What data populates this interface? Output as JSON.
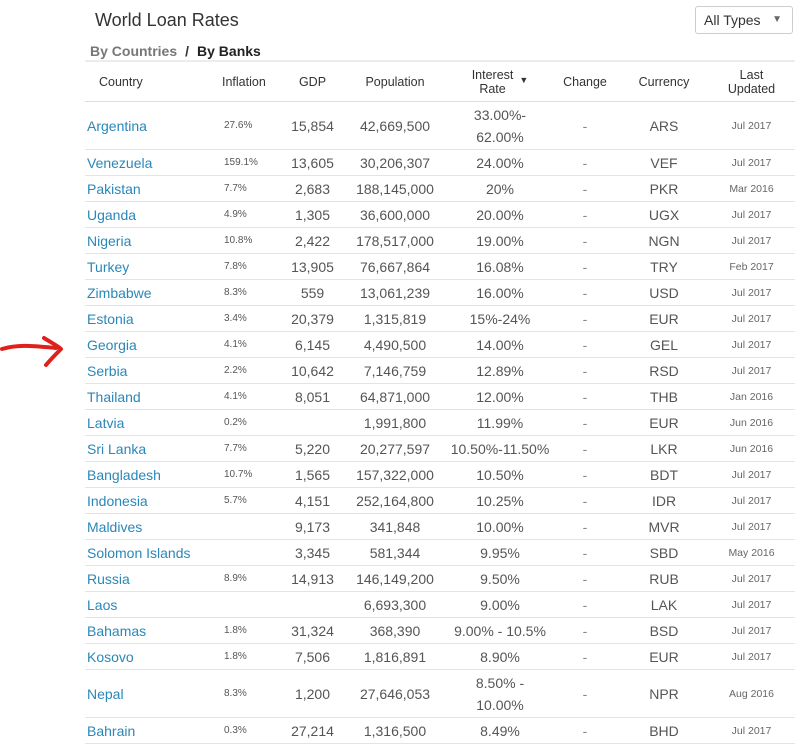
{
  "header": {
    "title": "World Loan Rates",
    "filter": {
      "selected": "All Types",
      "caret": "▼"
    },
    "tabs": {
      "by_countries": "By Countries",
      "separator": "/",
      "by_banks": "By Banks"
    }
  },
  "table": {
    "columns": {
      "country": "Country",
      "inflation": "Inflation",
      "gdp": "GDP",
      "population": "Population",
      "interest_line1": "Interest",
      "interest_line2": "Rate",
      "change": "Change",
      "currency": "Currency",
      "updated_line1": "Last",
      "updated_line2": "Updated"
    },
    "rows": [
      {
        "country": "Argentina",
        "inflation": "27.6%",
        "gdp": "15,854",
        "population": "42,669,500",
        "rate": "33.00%-",
        "rate2": "62.00%",
        "change": "-",
        "currency": "ARS",
        "updated": "Jul 2017"
      },
      {
        "country": "Venezuela",
        "inflation": "159.1%",
        "gdp": "13,605",
        "population": "30,206,307",
        "rate": "24.00%",
        "change": "-",
        "currency": "VEF",
        "updated": "Jul 2017"
      },
      {
        "country": "Pakistan",
        "inflation": "7.7%",
        "gdp": "2,683",
        "population": "188,145,000",
        "rate": "20%",
        "change": "-",
        "currency": "PKR",
        "updated": "Mar 2016"
      },
      {
        "country": "Uganda",
        "inflation": "4.9%",
        "gdp": "1,305",
        "population": "36,600,000",
        "rate": "20.00%",
        "change": "-",
        "currency": "UGX",
        "updated": "Jul 2017"
      },
      {
        "country": "Nigeria",
        "inflation": "10.8%",
        "gdp": "2,422",
        "population": "178,517,000",
        "rate": "19.00%",
        "change": "-",
        "currency": "NGN",
        "updated": "Jul 2017"
      },
      {
        "country": "Turkey",
        "inflation": "7.8%",
        "gdp": "13,905",
        "population": "76,667,864",
        "rate": "16.08%",
        "change": "-",
        "currency": "TRY",
        "updated": "Feb 2017"
      },
      {
        "country": "Zimbabwe",
        "inflation": "8.3%",
        "gdp": "559",
        "population": "13,061,239",
        "rate": "16.00%",
        "change": "-",
        "currency": "USD",
        "updated": "Jul 2017"
      },
      {
        "country": "Estonia",
        "inflation": "3.4%",
        "gdp": "20,379",
        "population": "1,315,819",
        "rate": "15%-24%",
        "change": "-",
        "currency": "EUR",
        "updated": "Jul 2017"
      },
      {
        "country": "Georgia",
        "inflation": "4.1%",
        "gdp": "6,145",
        "population": "4,490,500",
        "rate": "14.00%",
        "change": "-",
        "currency": "GEL",
        "updated": "Jul 2017"
      },
      {
        "country": "Serbia",
        "inflation": "2.2%",
        "gdp": "10,642",
        "population": "7,146,759",
        "rate": "12.89%",
        "change": "-",
        "currency": "RSD",
        "updated": "Jul 2017"
      },
      {
        "country": "Thailand",
        "inflation": "4.1%",
        "gdp": "8,051",
        "population": "64,871,000",
        "rate": "12.00%",
        "change": "-",
        "currency": "THB",
        "updated": "Jan 2016"
      },
      {
        "country": "Latvia",
        "inflation": "0.2%",
        "gdp": "",
        "population": "1,991,800",
        "rate": "11.99%",
        "change": "-",
        "currency": "EUR",
        "updated": "Jun 2016"
      },
      {
        "country": "Sri Lanka",
        "inflation": "7.7%",
        "gdp": "5,220",
        "population": "20,277,597",
        "rate": "10.50%-11.50%",
        "change": "-",
        "currency": "LKR",
        "updated": "Jun 2016"
      },
      {
        "country": "Bangladesh",
        "inflation": "10.7%",
        "gdp": "1,565",
        "population": "157,322,000",
        "rate": "10.50%",
        "change": "-",
        "currency": "BDT",
        "updated": "Jul 2017"
      },
      {
        "country": "Indonesia",
        "inflation": "5.7%",
        "gdp": "4,151",
        "population": "252,164,800",
        "rate": "10.25%",
        "change": "-",
        "currency": "IDR",
        "updated": "Jul 2017"
      },
      {
        "country": "Maldives",
        "inflation": "",
        "gdp": "9,173",
        "population": "341,848",
        "rate": "10.00%",
        "change": "-",
        "currency": "MVR",
        "updated": "Jul 2017"
      },
      {
        "country": "Solomon Islands",
        "inflation": "",
        "gdp": "3,345",
        "population": "581,344",
        "rate": "9.95%",
        "change": "-",
        "currency": "SBD",
        "updated": "May 2016"
      },
      {
        "country": "Russia",
        "inflation": "8.9%",
        "gdp": "14,913",
        "population": "146,149,200",
        "rate": "9.50%",
        "change": "-",
        "currency": "RUB",
        "updated": "Jul 2017"
      },
      {
        "country": "Laos",
        "inflation": "",
        "gdp": "",
        "population": "6,693,300",
        "rate": "9.00%",
        "change": "-",
        "currency": "LAK",
        "updated": "Jul 2017"
      },
      {
        "country": "Bahamas",
        "inflation": "1.8%",
        "gdp": "31,324",
        "population": "368,390",
        "rate": "9.00% - 10.5%",
        "change": "-",
        "currency": "BSD",
        "updated": "Jul 2017"
      },
      {
        "country": "Kosovo",
        "inflation": "1.8%",
        "gdp": "7,506",
        "population": "1,816,891",
        "rate": "8.90%",
        "change": "-",
        "currency": "EUR",
        "updated": "Jul 2017"
      },
      {
        "country": "Nepal",
        "inflation": "8.3%",
        "gdp": "1,200",
        "population": "27,646,053",
        "rate": "8.50% -",
        "rate2": "10.00%",
        "change": "-",
        "currency": "NPR",
        "updated": "Aug 2016"
      },
      {
        "country": "Bahrain",
        "inflation": "0.3%",
        "gdp": "27,214",
        "population": "1,316,500",
        "rate": "8.49%",
        "change": "-",
        "currency": "BHD",
        "updated": "Jul 2017"
      }
    ]
  },
  "annotation": {
    "arrow_color": "#e0201b"
  }
}
